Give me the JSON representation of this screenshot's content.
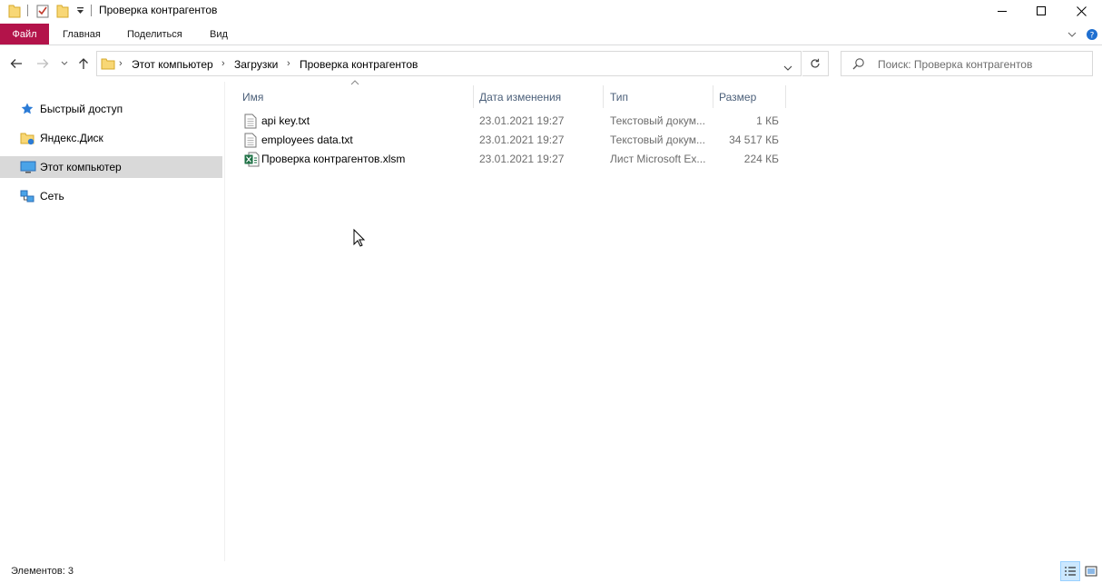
{
  "window": {
    "title": "Проверка контрагентов"
  },
  "ribbon": {
    "file_label": "Файл",
    "tabs": [
      "Главная",
      "Поделиться",
      "Вид"
    ]
  },
  "address": {
    "crumbs": [
      "Этот компьютер",
      "Загрузки",
      "Проверка контрагентов"
    ]
  },
  "search": {
    "placeholder": "Поиск: Проверка контрагентов"
  },
  "nav": {
    "items": [
      {
        "label": "Быстрый доступ",
        "icon": "star-icon"
      },
      {
        "label": "Яндекс.Диск",
        "icon": "yandex-disk-icon"
      },
      {
        "label": "Этот компьютер",
        "icon": "computer-icon",
        "selected": true
      },
      {
        "label": "Сеть",
        "icon": "network-icon"
      }
    ]
  },
  "columns": {
    "name": "Имя",
    "date": "Дата изменения",
    "type": "Тип",
    "size": "Размер"
  },
  "files": [
    {
      "name": "api key.txt",
      "date": "23.01.2021 19:27",
      "type": "Текстовый докум...",
      "size": "1 КБ",
      "icon": "text-file-icon"
    },
    {
      "name": "employees data.txt",
      "date": "23.01.2021 19:27",
      "type": "Текстовый докум...",
      "size": "34 517 КБ",
      "icon": "text-file-icon"
    },
    {
      "name": "Проверка контрагентов.xlsm",
      "date": "23.01.2021 19:27",
      "type": "Лист Microsoft Ex...",
      "size": "224 КБ",
      "icon": "excel-file-icon"
    }
  ],
  "status": {
    "items_count": "Элементов: 3"
  },
  "colors": {
    "file_tab": "#b3134a",
    "selection": "#d9d9d9",
    "folder": "#f8d775",
    "excel": "#1e7145"
  }
}
